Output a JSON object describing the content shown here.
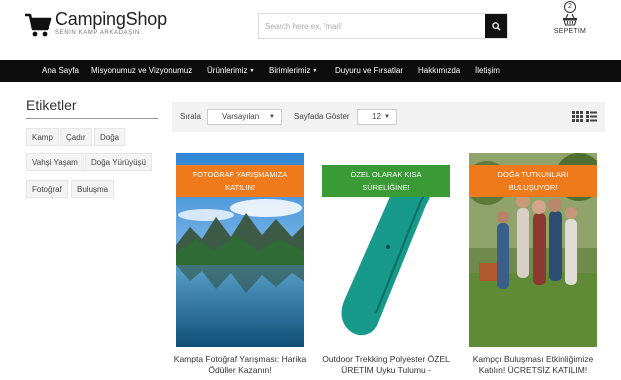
{
  "header": {
    "logo_name": "CampingShop",
    "logo_tagline": "SENİN KAMP ARKADAŞIN",
    "search_placeholder": "Search here ex. 'mari'",
    "cart_count": "2",
    "cart_label": "SEPETİM"
  },
  "nav": {
    "items": [
      {
        "label": "Ana Sayfa"
      },
      {
        "label": "Misyonumuz ve Vizyonumuz"
      },
      {
        "label": "Ürünlerimiz"
      },
      {
        "label": "Birimlerimiz"
      },
      {
        "label": "Duyuru ve Fırsatlar"
      },
      {
        "label": "Hakkımızda"
      },
      {
        "label": "İletişim"
      }
    ]
  },
  "sidebar": {
    "title": "Etiketler",
    "tags": [
      "Kamp",
      "Çadır",
      "Doğa",
      "Vahşi Yaşam",
      "Doğa Yürüyüşü",
      "Fotoğraf",
      "Buluşma"
    ]
  },
  "toolbar": {
    "sort_label": "Sırala",
    "sort_value": "Varsayılan",
    "per_page_label": "Sayfada Göster",
    "per_page_value": "12"
  },
  "products": [
    {
      "banner": "FOTOĞRAF YARIŞMAMIZA KATILIN!",
      "title": "Kampta Fotoğraf Yarışması: Harika Ödüller Kazanın!",
      "banner_color": "#ef7a1b"
    },
    {
      "banner": "ÖZEL OLARAK KISA SÜRELİĞİNE!",
      "title": "Outdoor Trekking Polyester ÖZEL ÜRETİM Uyku Tulumu -",
      "banner_color": "#3a9a35"
    },
    {
      "banner": "DOĞA TUTKUNLARI BULUŞUYOR!",
      "title": "Kampçı Buluşması Etkinliğimize Katılın! ÜCRETSİZ KATILIM!",
      "banner_color": "#ef7a1b"
    }
  ],
  "colors": {
    "nav_bg": "#0d0d0d",
    "accent_orange": "#ef7a1b",
    "accent_green": "#3a9a35"
  }
}
